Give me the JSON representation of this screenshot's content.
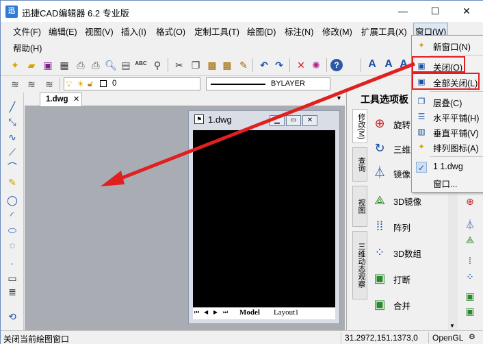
{
  "window": {
    "logo_text": "迅",
    "title": "迅捷CAD编辑器 6.2 专业版",
    "min_glyph": "—",
    "max_glyph": "☐",
    "close_glyph": "✕"
  },
  "menu": {
    "items": [
      "文件(F)",
      "编辑(E)",
      "视图(V)",
      "插入(I)",
      "格式(O)",
      "定制工具(T)",
      "绘图(D)",
      "标注(N)",
      "修改(M)",
      "扩展工具(X)",
      "窗口(W)"
    ],
    "help": "帮助(H)"
  },
  "toolbar2": {
    "layer_value": "0",
    "linetype_value": "BYLAYER"
  },
  "document": {
    "tab_label": "1.dwg",
    "tab_close": "✕"
  },
  "child_window": {
    "title": "1.dwg",
    "tab_model": "Model",
    "tab_layout": "Layout1"
  },
  "palette": {
    "title": "工具选项板",
    "vtabs": [
      "修改(M)",
      "查询",
      "视图",
      "三维动态观察"
    ],
    "items": [
      {
        "label": "旋转",
        "icon": "rotate-icon"
      },
      {
        "label": "三维旋转",
        "icon": "rotate3d-icon"
      },
      {
        "label": "镜像",
        "icon": "mirror-icon"
      },
      {
        "label": "3D镜像",
        "icon": "mirror3d-icon"
      },
      {
        "label": "阵列",
        "icon": "array-icon"
      },
      {
        "label": "3D数组",
        "icon": "array3d-icon"
      },
      {
        "label": "打断",
        "icon": "break-icon"
      },
      {
        "label": "合并",
        "icon": "join-icon"
      }
    ]
  },
  "window_menu": {
    "items": [
      {
        "label": "新窗口(N)",
        "icon": "new-window-icon"
      },
      {
        "label": "关闭(O)",
        "icon": "close-window-icon"
      },
      {
        "label": "全部关闭(L)",
        "icon": "close-all-icon"
      },
      {
        "label": "层叠(C)",
        "icon": "cascade-icon"
      },
      {
        "label": "水平平铺(H)",
        "icon": "tile-horizontal-icon"
      },
      {
        "label": "垂直平铺(V)",
        "icon": "tile-vertical-icon"
      },
      {
        "label": "排列图标(A)",
        "icon": "arrange-icons-icon"
      },
      {
        "label": "1 1.dwg",
        "icon": "check-icon"
      },
      {
        "label": "窗口...",
        "icon": ""
      }
    ]
  },
  "status": {
    "message": "关闭当前绘图窗口",
    "coords": "31.2972,151.1373,0",
    "renderer": "OpenGL"
  },
  "colors": {
    "highlight_red": "#e02020",
    "accent_blue": "#2c7bd6"
  }
}
